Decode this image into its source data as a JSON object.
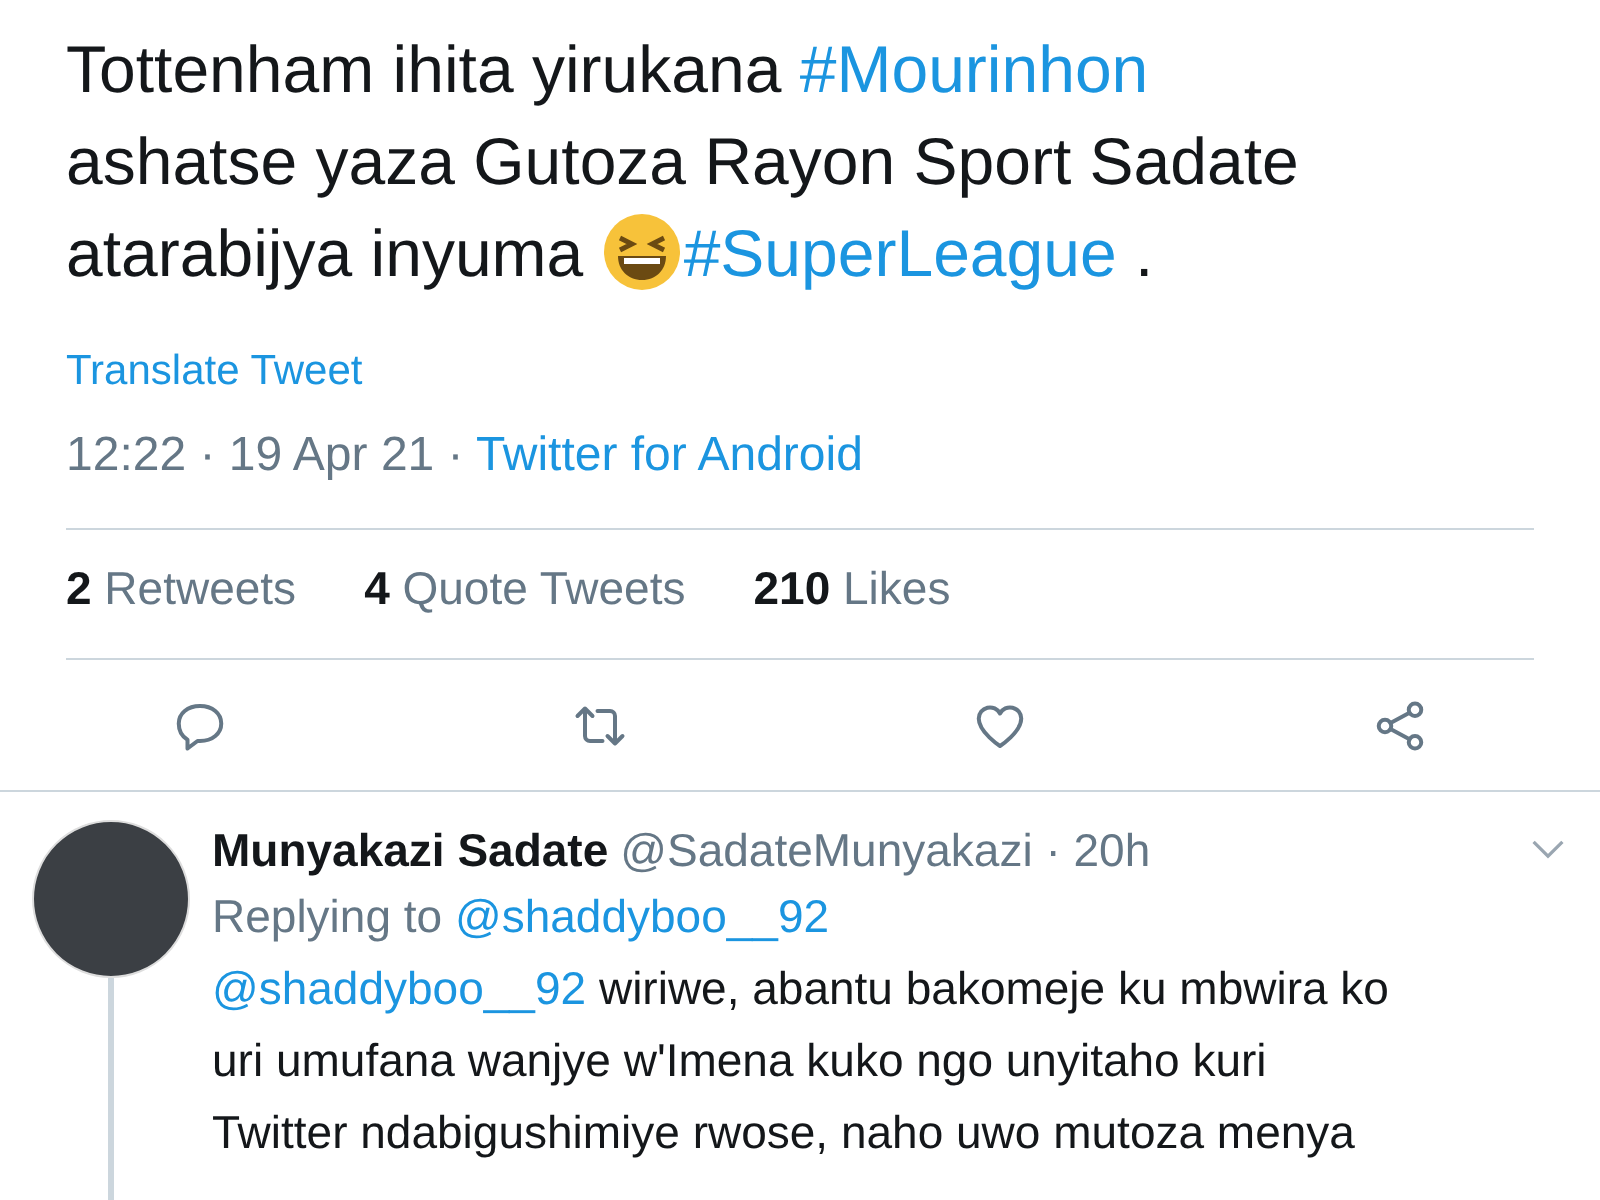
{
  "tweet": {
    "lines": [
      [
        {
          "kind": "text",
          "text": "Tottenham ihita yirukana "
        },
        {
          "kind": "hashtag",
          "text": "#Mourinhon"
        }
      ],
      [
        {
          "kind": "text",
          "text": "ashatse yaza Gutoza Rayon Sport Sadate"
        }
      ],
      [
        {
          "kind": "text",
          "text": "atarabijya inyuma "
        },
        {
          "kind": "emoji"
        },
        {
          "kind": "hashtag",
          "text": "#SuperLeague"
        },
        {
          "kind": "text",
          "text": " ."
        }
      ]
    ],
    "translate": "Translate Tweet",
    "time": "12:22 · 19 Apr 21 · ",
    "source": "Twitter for Android",
    "stats": [
      {
        "count": "2",
        "label": "Retweets"
      },
      {
        "count": "4",
        "label": "Quote Tweets"
      },
      {
        "count": "210",
        "label": "Likes"
      }
    ],
    "actions": [
      {
        "kind": "reply"
      },
      {
        "kind": "retweet"
      },
      {
        "kind": "like"
      },
      {
        "kind": "share"
      }
    ]
  },
  "reply": {
    "name": "Munyakazi Sadate",
    "handle": "@SadateMunyakazi · 20h",
    "replying_prefix": "Replying to ",
    "replying_to": "@shaddyboo__92",
    "lines": [
      [
        {
          "kind": "mention",
          "text": "@shaddyboo__92"
        },
        {
          "kind": "text",
          "text": " wiriwe, abantu bakomeje ku mbwira ko"
        }
      ],
      [
        {
          "kind": "text",
          "text": "uri umufana wanjye w'Imena kuko ngo unyitaho kuri"
        }
      ],
      [
        {
          "kind": "text",
          "text": "Twitter ndabigushimiye rwose, naho uwo mutoza menya"
        }
      ]
    ]
  }
}
